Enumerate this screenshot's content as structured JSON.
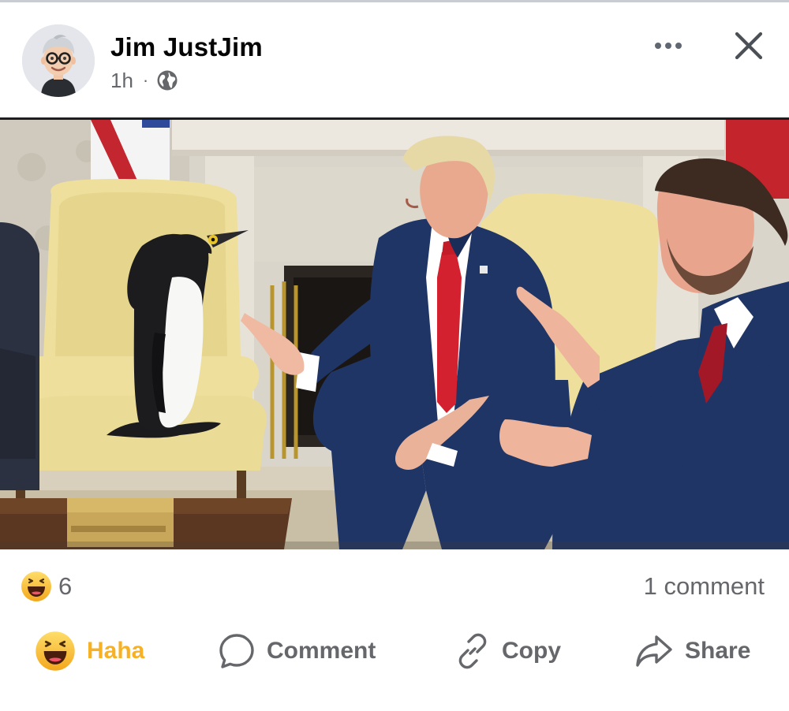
{
  "post": {
    "author_name": "Jim JustJim",
    "timestamp": "1h",
    "separator": "·",
    "audience_icon": "globe-icon",
    "image_alt": "Photo in a formal office: a penguin standing on a yellow armchair, a man in a blue suit and red tie gesturing toward it, and another man in a blue suit gesturing from the right"
  },
  "header_controls": {
    "more_icon": "more-horizontal-icon",
    "close_icon": "close-icon"
  },
  "stats": {
    "reaction_icon": "haha-emoji-icon",
    "reaction_count": "6",
    "comment_count_text": "1 comment"
  },
  "actions": [
    {
      "label": "Haha",
      "icon": "haha-emoji-icon"
    },
    {
      "label": "Comment",
      "icon": "comment-bubble-icon"
    },
    {
      "label": "Copy",
      "icon": "link-icon"
    },
    {
      "label": "Share",
      "icon": "share-arrow-icon"
    }
  ],
  "colors": {
    "reaction_accent": "#f7b125",
    "secondary_text": "#65676b",
    "primary_text": "#050505",
    "suit_blue": "#1f3566",
    "tie_red": "#d3212f",
    "chair_yellow": "#eedf9c"
  }
}
